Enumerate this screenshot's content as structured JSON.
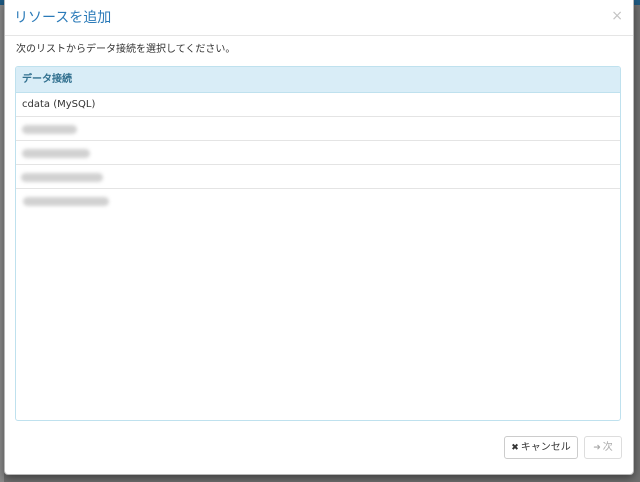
{
  "dialog": {
    "title": "リソースを追加",
    "close_glyph": "×",
    "instruction": "次のリストからデータ接続を選択してください。"
  },
  "list": {
    "header": "データ接続",
    "items": [
      {
        "label": "cdata (MySQL)",
        "blurred": false
      },
      {
        "label": "",
        "blurred": true
      },
      {
        "label": "",
        "blurred": true
      },
      {
        "label": "",
        "blurred": true
      },
      {
        "label": "",
        "blurred": true
      }
    ]
  },
  "footer": {
    "cancel_icon": "✖",
    "cancel_label": "キャンセル",
    "next_icon": "➜",
    "next_label": "次"
  },
  "colors": {
    "title": "#2a7ab8",
    "list_header_bg": "#d9edf7",
    "list_header_text": "#31708f",
    "backdrop": "#6f6f6f",
    "top_bar": "#1e5a82"
  }
}
